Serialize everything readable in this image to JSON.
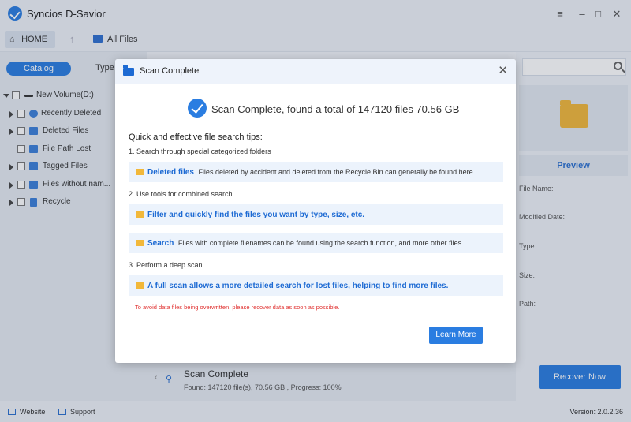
{
  "app": {
    "title": "Syncios D-Savior",
    "version": "Version: 2.0.2.36"
  },
  "toolbar": {
    "home_label": "HOME",
    "all_files_label": "All Files"
  },
  "sidebar": {
    "tabs": [
      "Catalog",
      "Type"
    ],
    "active_tab": "Catalog",
    "items": [
      {
        "label": "New Volume(D:)",
        "icon": "drive-icon",
        "expanded": true
      },
      {
        "label": "Recently Deleted",
        "icon": "recent-icon"
      },
      {
        "label": "Deleted Files",
        "icon": "deleted-files-icon"
      },
      {
        "label": "File Path Lost",
        "icon": "path-lost-icon"
      },
      {
        "label": "Tagged Files",
        "icon": "tag-icon"
      },
      {
        "label": "Files without nam...",
        "icon": "noname-icon"
      },
      {
        "label": "Recycle",
        "icon": "recycle-icon"
      }
    ]
  },
  "right_panel": {
    "preview_label": "Preview",
    "meta_labels": [
      "File Name:",
      "Modified Date:",
      "Type:",
      "Size:",
      "Path:"
    ]
  },
  "status": {
    "title": "Scan Complete",
    "detail": "Found: 147120 file(s), 70.56 GB , Progress: 100%",
    "recover_label": "Recover Now"
  },
  "footer": {
    "website_label": "Website",
    "support_label": "Support"
  },
  "dialog": {
    "title": "Scan Complete",
    "summary": "Scan Complete, found a total of  147120  files 70.56 GB",
    "tips_heading": "Quick and effective file search tips:",
    "step1": "1.  Search through special categorized folders",
    "tip1_strong": "Deleted files",
    "tip1_text": "Files deleted by accident and deleted from the Recycle Bin can generally be found here.",
    "step2": "2.  Use tools for combined search",
    "tip2_strong": "Filter and quickly find the files you want by type, size, etc.",
    "tip3_strong": "Search",
    "tip3_text": "Files with complete filenames can be found using the search function, and more other files.",
    "step3": "3.  Perform a deep scan",
    "tip4_strong": "A full scan allows a more detailed search for lost files, helping to find more files.",
    "warning": "To avoid data files being overwritten, please recover data as soon as possible.",
    "learn_more_label": "Learn More"
  },
  "colors": {
    "accent": "#2a7de1",
    "warning": "#e0302f",
    "folder": "#f2b83a"
  }
}
